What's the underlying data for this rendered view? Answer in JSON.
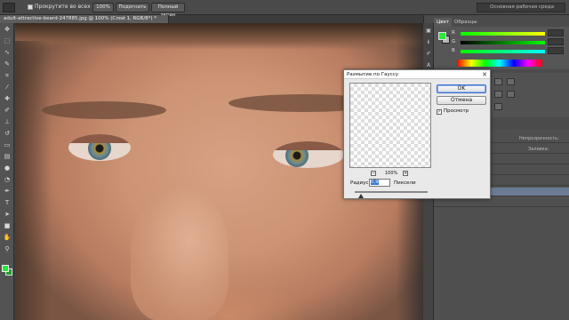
{
  "options_bar": {
    "scroll_all_label": "Прокрутите во всех окнах",
    "buttons": [
      "100%",
      "Подогнать",
      "Полный экран"
    ],
    "workspace": "Основная рабочая среда"
  },
  "document": {
    "tab_title": "adult-attractive-beard-247885.jpg @ 100% (Слой 1, RGB/8*) *"
  },
  "toolbar": {
    "tools": [
      "move-tool",
      "marquee-tool",
      "lasso-tool",
      "quick-select-tool",
      "crop-tool",
      "eyedropper-tool",
      "healing-tool",
      "brush-tool",
      "clone-stamp-tool",
      "history-brush-tool",
      "eraser-tool",
      "gradient-tool",
      "blur-tool",
      "dodge-tool",
      "pen-tool",
      "type-tool",
      "path-select-tool",
      "shape-tool",
      "hand-tool",
      "zoom-tool"
    ],
    "foreground_color": "#29e83a",
    "background_color": "#1f9f2a"
  },
  "panels": {
    "tabs": [
      "Цвет",
      "Образцы"
    ],
    "color_channels": [
      "R",
      "G",
      "B"
    ],
    "layers": {
      "opacity_label": "Непрозрачность:",
      "fill_label": "Заливка:"
    }
  },
  "dialog": {
    "title": "Размытие по Гауссу",
    "ok_label": "OK",
    "cancel_label": "Отмена",
    "preview_label": "Просмотр",
    "preview_checked": true,
    "zoom": "100%",
    "radius_label": "Радиус:",
    "radius_value": "0,9",
    "radius_unit": "Пиксели",
    "zoom_out_symbol": "−",
    "zoom_in_symbol": "+",
    "check_mark": "✓",
    "close_symbol": "✕"
  }
}
